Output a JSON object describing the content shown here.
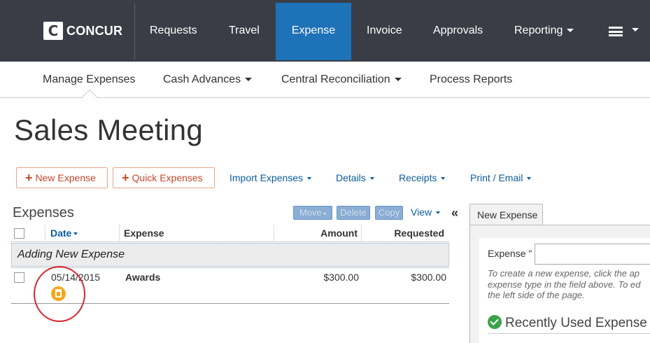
{
  "app": {
    "logo_letter": "C",
    "logo_text": "CONCUR"
  },
  "topnav": {
    "items": [
      {
        "label": "Requests"
      },
      {
        "label": "Travel"
      },
      {
        "label": "Expense",
        "active": true
      },
      {
        "label": "Invoice"
      },
      {
        "label": "Approvals"
      },
      {
        "label": "Reporting"
      }
    ],
    "menu_icon": "hamburger-menu-icon"
  },
  "subnav": {
    "items": [
      {
        "label": "Manage Expenses"
      },
      {
        "label": "Cash Advances"
      },
      {
        "label": "Central Reconciliation"
      },
      {
        "label": "Process Reports"
      }
    ]
  },
  "page": {
    "title": "Sales Meeting"
  },
  "actions": {
    "new_expense": "New Expense",
    "quick_expenses": "Quick Expenses",
    "import_expenses": "Import Expenses",
    "details": "Details",
    "receipts": "Receipts",
    "print_email": "Print / Email"
  },
  "expenses": {
    "heading": "Expenses",
    "move": "Move",
    "delete": "Delete",
    "copy": "Copy",
    "view": "View",
    "collapse_symbol": "«",
    "columns": {
      "date": "Date",
      "expense": "Expense",
      "amount": "Amount",
      "requested": "Requested"
    },
    "adding_label": "Adding New Expense",
    "rows": [
      {
        "date": "05/14/2015",
        "expense": "Awards",
        "amount": "$300.00",
        "requested": "$300.00",
        "icon": "receipt-icon"
      }
    ]
  },
  "panel": {
    "tab": "New Expense",
    "field_label": "Expense \"",
    "help_lines": [
      "To create a new expense, click the ap",
      "expense type in the field above. To ed",
      "the left side of the page."
    ],
    "recent_heading": "Recently Used Expense"
  },
  "colors": {
    "nav_bg": "#3a3d46",
    "nav_active": "#1e72b8",
    "accent_red": "#c6472b",
    "link_blue": "#0b5c9f",
    "receipt_orange": "#f3a81b",
    "annotation_red": "#d9272e",
    "check_green": "#3aa34a"
  }
}
